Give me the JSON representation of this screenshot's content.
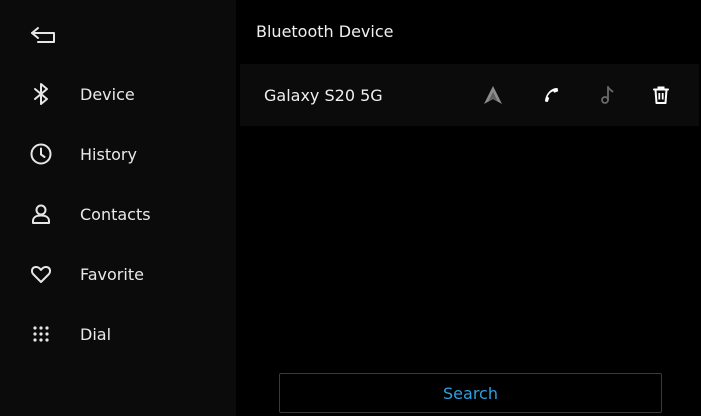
{
  "header": {
    "title": "Bluetooth Device"
  },
  "sidebar": {
    "items": [
      {
        "label": "Device",
        "icon": "bluetooth-icon"
      },
      {
        "label": "History",
        "icon": "clock-icon"
      },
      {
        "label": "Contacts",
        "icon": "person-icon"
      },
      {
        "label": "Favorite",
        "icon": "heart-icon"
      },
      {
        "label": "Dial",
        "icon": "dialpad-icon"
      }
    ]
  },
  "device": {
    "name": "Galaxy S20 5G",
    "actions": [
      "android-auto-icon",
      "phone-icon",
      "music-note-icon",
      "trash-icon"
    ]
  },
  "search": {
    "label": "Search"
  },
  "colors": {
    "accent": "#2e9fe0",
    "background": "#000000",
    "panel": "#0b0b0b"
  }
}
